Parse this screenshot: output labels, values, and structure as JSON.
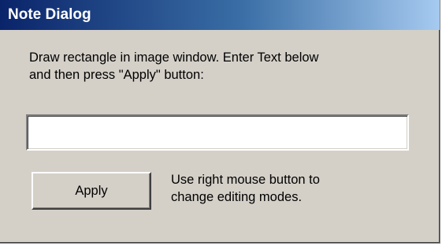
{
  "window": {
    "title": "Note Dialog"
  },
  "dialog": {
    "instructions": "Draw rectangle in image window. Enter Text below\nand then press \"Apply\" button:",
    "note_input_value": "",
    "apply_label": "Apply",
    "hint": "Use right mouse button to\nchange editing modes."
  },
  "colors": {
    "title_bar_start": "#0a246a",
    "title_bar_end": "#a6caf0",
    "dialog_face": "#d4d0c8"
  }
}
